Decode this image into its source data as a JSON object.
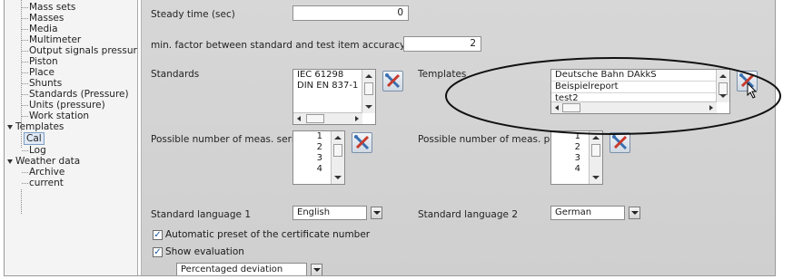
{
  "tree": {
    "items": [
      {
        "label": "Mass sets"
      },
      {
        "label": "Masses"
      },
      {
        "label": "Media"
      },
      {
        "label": "Multimeter"
      },
      {
        "label": "Output signals pressur"
      },
      {
        "label": "Piston"
      },
      {
        "label": "Place"
      },
      {
        "label": "Shunts"
      },
      {
        "label": "Standards (Pressure)"
      },
      {
        "label": "Units (pressure)"
      },
      {
        "label": "Work station"
      },
      {
        "label": "Templates"
      },
      {
        "label": "Cal"
      },
      {
        "label": "Log"
      },
      {
        "label": "Weather data"
      },
      {
        "label": "Archive"
      },
      {
        "label": "current"
      }
    ]
  },
  "settings": {
    "steady_time_label": "Steady time (sec)",
    "steady_time_value": "0",
    "min_factor_label": "min. factor between standard and test item accuracy",
    "min_factor_value": "2",
    "standards_label": "Standards",
    "standards_items": [
      "IEC 61298",
      "DIN EN 837-1"
    ],
    "templates_label": "Templates",
    "templates_items": [
      "Deutsche Bahn DAkkS",
      "Beispielreport",
      "test2"
    ],
    "series_label": "Possible number of meas. series",
    "series_items": [
      "1",
      "2",
      "3",
      "4"
    ],
    "points_label": "Possible number of meas. points",
    "points_items": [
      "1",
      "2",
      "3",
      "4"
    ],
    "lang1_label": "Standard language 1",
    "lang1_value": "English",
    "lang2_label": "Standard language 2",
    "lang2_value": "German",
    "auto_preset_label": "Automatic preset of the certificate number",
    "auto_preset_checked": true,
    "show_eval_label": "Show evaluation",
    "show_eval_checked": true,
    "deviation_value": "Percentaged deviation"
  },
  "icons": {
    "tool_button": "tools-icon",
    "cursor": "mouse-pointer-icon",
    "highlight": "highlight-ellipse"
  },
  "colors": {
    "panel_bg": "#d3d3d3",
    "tree_bg": "#f4f4f4",
    "selection": "#dfe9f5",
    "ellipse": "#111111"
  }
}
